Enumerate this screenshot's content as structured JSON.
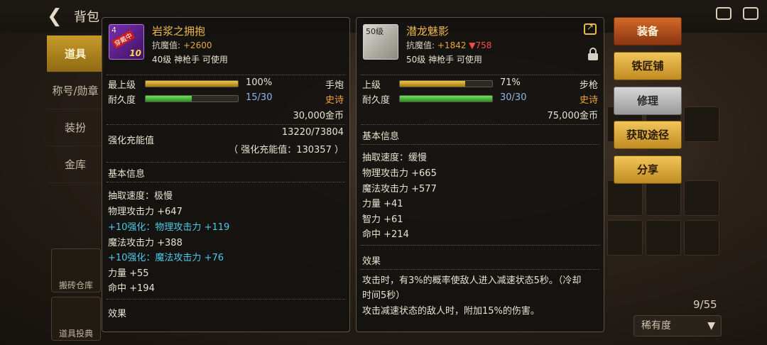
{
  "topbar": {
    "back_label": "背包"
  },
  "nav": {
    "items": [
      "道具",
      "称号/勋章",
      "装扮",
      "金库"
    ],
    "active": 0,
    "bottom_items": [
      "搬砖仓库",
      "道具投典"
    ]
  },
  "inventory": {
    "counter": "9/55",
    "rarity_select": "稀有度"
  },
  "left_item": {
    "name": "岩浆之拥抱",
    "icon_level": "4",
    "icon_badge": "穿戴中",
    "icon_enhance": "10",
    "resist_label": "抗魔值:",
    "resist_value": "+2600",
    "requirement": "40级 神枪手 可使用",
    "grade": "最上级",
    "grade_pct": "100%",
    "grade_fill": 1.0,
    "weapon_type": "手炮",
    "durability_label": "耐久度",
    "durability": "15/30",
    "durability_fill": 0.5,
    "rarity": "史诗",
    "price": "30,000金币",
    "enh_label": "强化充能值",
    "enh_value": "13220/73804",
    "enh_total": "（ 强化充能值：130357 ）",
    "basic_info_title": "基本信息",
    "stats": [
      {
        "text": "抽取速度：极慢",
        "highlight": false
      },
      {
        "text": "物理攻击力 +647",
        "highlight": false
      },
      {
        "text": "+10强化：物理攻击力 +119",
        "highlight": true
      },
      {
        "text": "魔法攻击力 +388",
        "highlight": false
      },
      {
        "text": "+10强化：魔法攻击力 +76",
        "highlight": true
      },
      {
        "text": "力量 +55",
        "highlight": false
      },
      {
        "text": "命中 +194",
        "highlight": false
      }
    ],
    "effect_title": "效果"
  },
  "right_item": {
    "name": "潜龙魅影",
    "icon_level": "50级",
    "resist_label": "抗魔值:",
    "resist_value": "+1842",
    "resist_diff": "▼758",
    "requirement": "50级 神枪手 可使用",
    "grade": "上级",
    "grade_pct": "71%",
    "grade_fill": 0.71,
    "weapon_type": "步枪",
    "durability_label": "耐久度",
    "durability": "30/30",
    "durability_fill": 1.0,
    "rarity": "史诗",
    "price": "75,000金币",
    "basic_info_title": "基本信息",
    "stats": [
      {
        "text": "抽取速度：缓慢"
      },
      {
        "text": "物理攻击力 +665"
      },
      {
        "text": "魔法攻击力 +577"
      },
      {
        "text": "力量 +41"
      },
      {
        "text": "智力 +61"
      },
      {
        "text": "命中 +214"
      }
    ],
    "effect_title": "效果",
    "effect_lines": [
      "攻击时，有3%的概率使敌人进入减速状态5秒。（冷却",
      "时间5秒）",
      "攻击减速状态的敌人时，附加15%的伤害。"
    ]
  },
  "buttons": {
    "equip": "装备",
    "blacksmith": "铁匠铺",
    "repair": "修理",
    "acquire": "获取途径",
    "share": "分享"
  },
  "colors": {
    "gold": "#f0b84a",
    "cyan": "#4ec9e8",
    "orange": "#f0a23a",
    "red": "#ff4a4a"
  }
}
